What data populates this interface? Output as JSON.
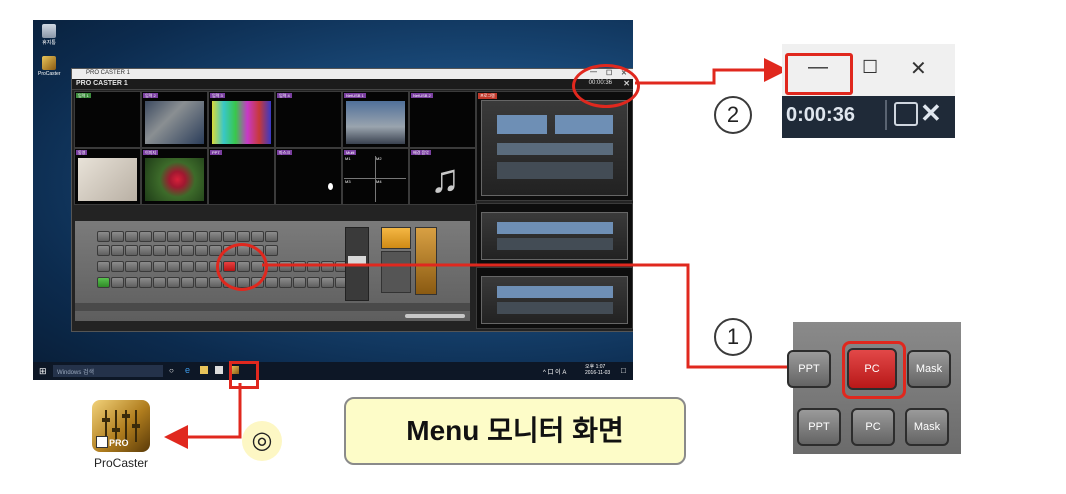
{
  "desktop": {
    "icons": [
      {
        "label": "휴지통"
      },
      {
        "label": "ProCaster"
      }
    ],
    "taskbar": {
      "search_placeholder": "Windows 검색",
      "tray_text": "^ 口 이 A",
      "clock": "오후 1:07\n2016-11-03"
    }
  },
  "app": {
    "title": "PRO CASTER 1",
    "header_name": "PRO CASTER 1",
    "clock": "00:00:36",
    "close_glyph": "✕",
    "preview_labels": [
      {
        "label": "입력 1",
        "color": "#3d8c3d"
      },
      {
        "label": "입력 2",
        "color": "#7a3fa0"
      },
      {
        "label": "입력 3",
        "color": "#7a3fa0"
      },
      {
        "label": "입력 4",
        "color": "#7a3fa0"
      },
      {
        "label": "NetUSB 1",
        "color": "#7a3fa0"
      },
      {
        "label": "NetUSB 2",
        "color": "#7a3fa0"
      },
      {
        "label": "동영",
        "color": "#7a3fa0"
      },
      {
        "label": "이미지",
        "color": "#7a3fa0"
      },
      {
        "label": "PPT",
        "color": "#7a3fa0"
      },
      {
        "label": "마스크",
        "color": "#7a3fa0"
      },
      {
        "label": "Multi",
        "color": "#7a3fa0"
      },
      {
        "label": "배경 음악",
        "color": "#7a3fa0"
      }
    ],
    "program_label": "프로그램",
    "multi_labels": [
      "M1",
      "M2",
      "M3",
      "M4"
    ]
  },
  "zoom2": {
    "minimize_glyph": "—",
    "maximize_glyph": "☐",
    "close_glyph": "✕",
    "timer": "0:00:36"
  },
  "zoom1": {
    "keys_top": [
      "PPT",
      "PC",
      "Mask"
    ],
    "keys_bottom": [
      "PPT",
      "PC",
      "Mask"
    ]
  },
  "annotations": {
    "num1": "1",
    "num2": "2",
    "mark": "◎",
    "caption": "Menu 모니터 화면",
    "procaster_badge": "PRO",
    "procaster_label": "ProCaster"
  },
  "colors": {
    "highlight": "#e0281e",
    "caption_bg": "#fdfcc8",
    "mark_bg": "#fdf7c4"
  }
}
